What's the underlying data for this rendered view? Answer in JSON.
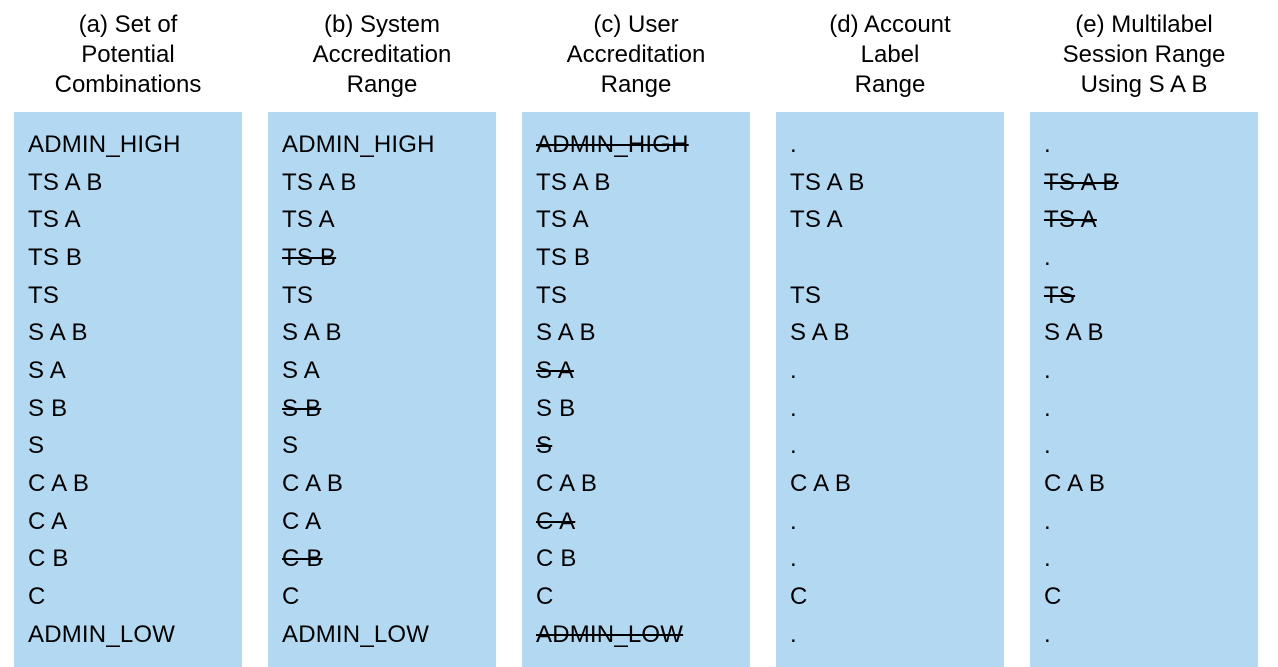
{
  "columns": [
    {
      "header": "(a) Set of\nPotential\nCombinations",
      "items": [
        {
          "text": "ADMIN_HIGH",
          "strike": false
        },
        {
          "text": "TS A B",
          "strike": false
        },
        {
          "text": "TS A",
          "strike": false
        },
        {
          "text": "TS B",
          "strike": false
        },
        {
          "text": "TS",
          "strike": false
        },
        {
          "text": "S A B",
          "strike": false
        },
        {
          "text": "S A",
          "strike": false
        },
        {
          "text": "S B",
          "strike": false
        },
        {
          "text": "S",
          "strike": false
        },
        {
          "text": "C A B",
          "strike": false
        },
        {
          "text": "C A",
          "strike": false
        },
        {
          "text": "C B",
          "strike": false
        },
        {
          "text": "C",
          "strike": false
        },
        {
          "text": "ADMIN_LOW",
          "strike": false
        }
      ]
    },
    {
      "header": "(b) System\nAccreditation\nRange",
      "items": [
        {
          "text": "ADMIN_HIGH",
          "strike": false
        },
        {
          "text": "TS A B",
          "strike": false
        },
        {
          "text": "TS A",
          "strike": false
        },
        {
          "text": "TS B",
          "strike": true
        },
        {
          "text": "TS",
          "strike": false
        },
        {
          "text": "S A B",
          "strike": false
        },
        {
          "text": "S A",
          "strike": false
        },
        {
          "text": "S B",
          "strike": true
        },
        {
          "text": "S",
          "strike": false
        },
        {
          "text": "C A B",
          "strike": false
        },
        {
          "text": "C A",
          "strike": false
        },
        {
          "text": "C B",
          "strike": true
        },
        {
          "text": "C",
          "strike": false
        },
        {
          "text": "ADMIN_LOW",
          "strike": false
        }
      ]
    },
    {
      "header": "(c) User\nAccreditation\nRange",
      "items": [
        {
          "text": "ADMIN_HIGH",
          "strike": true
        },
        {
          "text": "TS A B",
          "strike": false
        },
        {
          "text": "TS A",
          "strike": false
        },
        {
          "text": "TS B",
          "strike": false
        },
        {
          "text": "TS",
          "strike": false
        },
        {
          "text": "S A B",
          "strike": false
        },
        {
          "text": "S A",
          "strike": true
        },
        {
          "text": "S B",
          "strike": false
        },
        {
          "text": "S",
          "strike": true
        },
        {
          "text": "C A B",
          "strike": false
        },
        {
          "text": "C A",
          "strike": true
        },
        {
          "text": "C B",
          "strike": false
        },
        {
          "text": "C",
          "strike": false
        },
        {
          "text": "ADMIN_LOW",
          "strike": true
        }
      ]
    },
    {
      "header": "(d) Account\nLabel\nRange",
      "items": [
        {
          "text": ".",
          "strike": false
        },
        {
          "text": "TS A B",
          "strike": false
        },
        {
          "text": "TS A",
          "strike": false
        },
        {
          "text": " ",
          "strike": false
        },
        {
          "text": "TS",
          "strike": false
        },
        {
          "text": "S A B",
          "strike": false
        },
        {
          "text": ".",
          "strike": false
        },
        {
          "text": ".",
          "strike": false
        },
        {
          "text": ".",
          "strike": false
        },
        {
          "text": "C A B",
          "strike": false
        },
        {
          "text": ".",
          "strike": false
        },
        {
          "text": ".",
          "strike": false
        },
        {
          "text": "C",
          "strike": false
        },
        {
          "text": ".",
          "strike": false
        }
      ]
    },
    {
      "header": "(e) Multilabel\nSession Range\nUsing S A B",
      "items": [
        {
          "text": ".",
          "strike": false
        },
        {
          "text": "TS A B",
          "strike": true
        },
        {
          "text": "TS A",
          "strike": true
        },
        {
          "text": ".",
          "strike": false
        },
        {
          "text": "TS",
          "strike": true
        },
        {
          "text": "S A B",
          "strike": false
        },
        {
          "text": ".",
          "strike": false
        },
        {
          "text": ".",
          "strike": false
        },
        {
          "text": ".",
          "strike": false
        },
        {
          "text": "C A B",
          "strike": false
        },
        {
          "text": ".",
          "strike": false
        },
        {
          "text": ".",
          "strike": false
        },
        {
          "text": "C",
          "strike": false
        },
        {
          "text": ".",
          "strike": false
        }
      ]
    }
  ]
}
